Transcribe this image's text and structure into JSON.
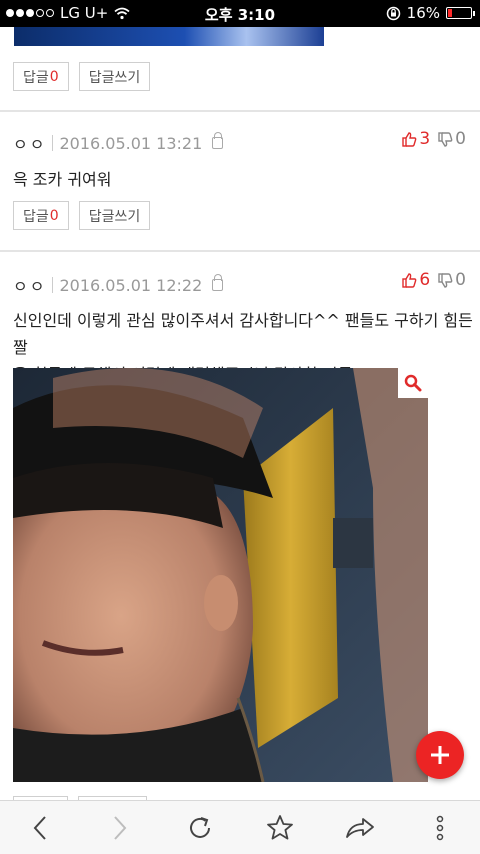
{
  "status_bar": {
    "carrier": "LG U+",
    "time": "오후 3:10",
    "battery": "16%",
    "battery_level": 0.16
  },
  "top_actions": {
    "reply_label": "답글",
    "reply_count": "0",
    "write_reply_label": "답글쓰기"
  },
  "comments": [
    {
      "author": "ㅇㅇ",
      "date": "2016.05.01 13:21",
      "likes": "3",
      "dislikes": "0",
      "text": "윽 조카 귀여워",
      "reply_label": "답글",
      "reply_count": "0",
      "write_reply_label": "답글쓰기"
    },
    {
      "author": "ㅇㅇ",
      "date": "2016.05.01 12:22",
      "likes": "6",
      "dislikes": "0",
      "text_line1": "신인인데 이렇게 관심 많이주셔서 감사합니다^^ 팬들도 구하기 힘든짤",
      "text_line2": "을 힘들게 구해서 이렇게 대령해주시닌 감사할 따름^^"
    }
  ],
  "icons": {
    "lock": "lock-icon",
    "thumbs_up": "thumbs-up-icon",
    "thumbs_down": "thumbs-down-icon",
    "zoom": "magnifier-icon",
    "fab": "plus-icon"
  },
  "colors": {
    "accent": "#ec2424",
    "like": "#e02b2b",
    "muted": "#999999"
  }
}
